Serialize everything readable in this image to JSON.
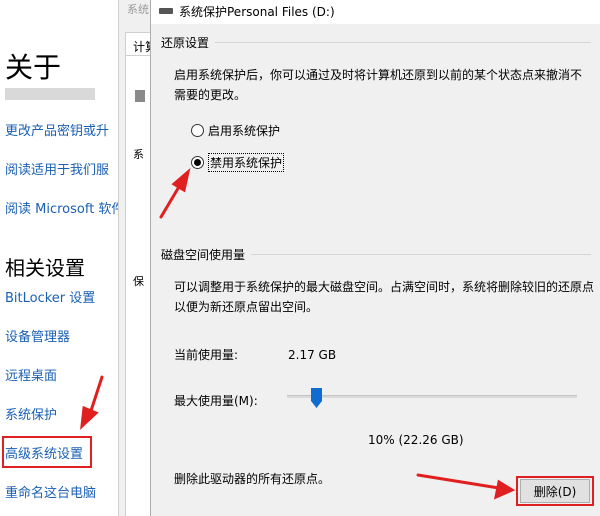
{
  "left_panel": {
    "about_title": "关于",
    "links_top": [
      "更改产品密钥或升",
      "阅读适用于我们服",
      "阅读 Microsoft 软件"
    ],
    "related_title": "相关设置",
    "related_links": [
      "BitLocker 设置",
      "设备管理器",
      "远程桌面",
      "系统保护",
      "高级系统设置",
      "重命名这台电脑"
    ]
  },
  "bg_window": {
    "title": "系统",
    "tab": "计算",
    "fragments": [
      "系",
      "保"
    ]
  },
  "dialog": {
    "title": "系统保护Personal Files (D:)",
    "restore": {
      "group_title": "还原设置",
      "description_line1": "启用系统保护后，你可以通过及时将计算机还原到以前的某个状态点来撤消不",
      "description_line2": "需要的更改。",
      "option_enable": "启用系统保护",
      "option_disable": "禁用系统保护",
      "selected": "禁用系统保护"
    },
    "disk": {
      "group_title": "磁盘空间使用量",
      "description_line1": "可以调整用于系统保护的最大磁盘空间。占满空间时，系统将删除较旧的还原点",
      "description_line2": "以便为新还原点留出空间。",
      "current_label": "当前使用量:",
      "current_value": "2.17 GB",
      "max_label": "最大使用量(M):",
      "max_value_text": "10% (22.26 GB)",
      "max_percent": 10,
      "delete_text": "删除此驱动器的所有还原点。",
      "delete_button": "删除(D)"
    }
  },
  "colors": {
    "link": "#1a5fb4",
    "annotation": "#e02020",
    "slider": "#0f6cd0"
  }
}
